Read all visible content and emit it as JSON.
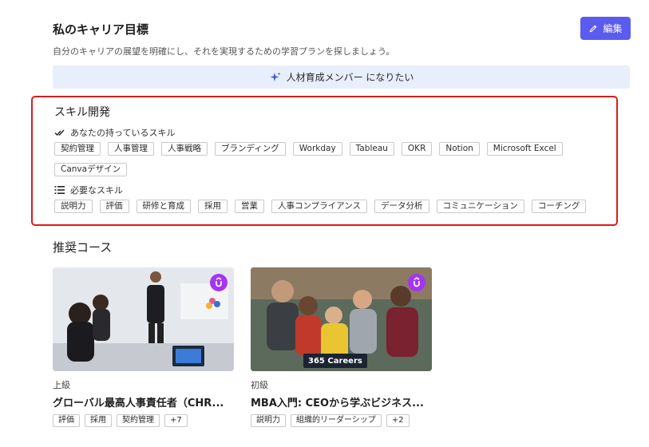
{
  "header": {
    "title": "私のキャリア目標",
    "subtitle": "自分のキャリアの展望を明確にし、それを実現するための学習プランを探しましょう。",
    "edit_label": "編集"
  },
  "goal_banner": {
    "text": "人材育成メンバー になりたい"
  },
  "skills": {
    "title": "スキル開発",
    "owned_heading": "あなたの持っているスキル",
    "owned": [
      "契約管理",
      "人事管理",
      "人事戦略",
      "ブランディング",
      "Workday",
      "Tableau",
      "OKR",
      "Notion",
      "Microsoft Excel",
      "Canvaデザイン"
    ],
    "required_heading": "必要なスキル",
    "required": [
      "説明力",
      "評価",
      "研修と育成",
      "採用",
      "営業",
      "人事コンプライアンス",
      "データ分析",
      "コミュニケーション",
      "コーチング"
    ]
  },
  "courses": {
    "title": "推奨コース",
    "items": [
      {
        "level": "上級",
        "name": "グローバル最高人事責任者（CHR...",
        "tags": [
          "評価",
          "採用",
          "契約管理",
          "+7"
        ]
      },
      {
        "level": "初級",
        "name": "MBA入門: CEOから学ぶビジネス...",
        "tags": [
          "説明力",
          "組織的リーダーシップ",
          "+2"
        ],
        "brand": "365 Careers"
      }
    ]
  },
  "colors": {
    "accent": "#5b5bf0",
    "banner_bg": "#e7eefc",
    "highlight_border": "#d91d1d",
    "udemy_purple": "#a435f0"
  }
}
